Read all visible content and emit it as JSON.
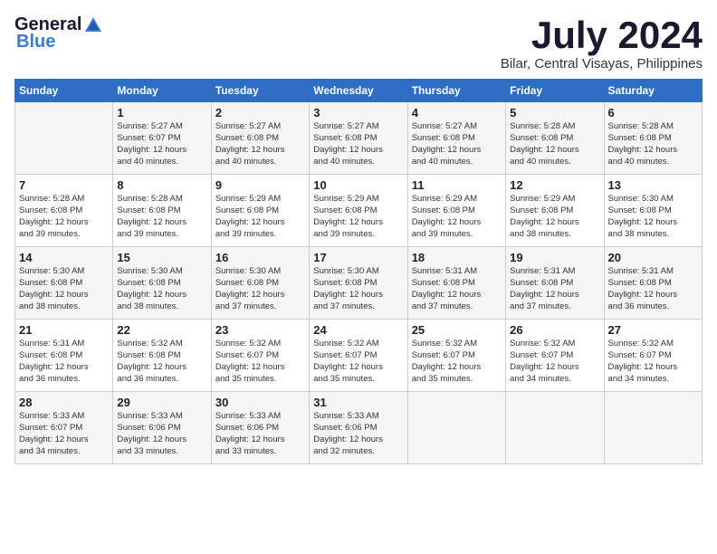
{
  "logo": {
    "general": "General",
    "blue": "Blue"
  },
  "title": {
    "month": "July 2024",
    "location": "Bilar, Central Visayas, Philippines"
  },
  "headers": [
    "Sunday",
    "Monday",
    "Tuesday",
    "Wednesday",
    "Thursday",
    "Friday",
    "Saturday"
  ],
  "weeks": [
    [
      {
        "day": "",
        "content": ""
      },
      {
        "day": "1",
        "content": "Sunrise: 5:27 AM\nSunset: 6:07 PM\nDaylight: 12 hours\nand 40 minutes."
      },
      {
        "day": "2",
        "content": "Sunrise: 5:27 AM\nSunset: 6:08 PM\nDaylight: 12 hours\nand 40 minutes."
      },
      {
        "day": "3",
        "content": "Sunrise: 5:27 AM\nSunset: 6:08 PM\nDaylight: 12 hours\nand 40 minutes."
      },
      {
        "day": "4",
        "content": "Sunrise: 5:27 AM\nSunset: 6:08 PM\nDaylight: 12 hours\nand 40 minutes."
      },
      {
        "day": "5",
        "content": "Sunrise: 5:28 AM\nSunset: 6:08 PM\nDaylight: 12 hours\nand 40 minutes."
      },
      {
        "day": "6",
        "content": "Sunrise: 5:28 AM\nSunset: 6:08 PM\nDaylight: 12 hours\nand 40 minutes."
      }
    ],
    [
      {
        "day": "7",
        "content": "Sunrise: 5:28 AM\nSunset: 6:08 PM\nDaylight: 12 hours\nand 39 minutes."
      },
      {
        "day": "8",
        "content": "Sunrise: 5:28 AM\nSunset: 6:08 PM\nDaylight: 12 hours\nand 39 minutes."
      },
      {
        "day": "9",
        "content": "Sunrise: 5:29 AM\nSunset: 6:08 PM\nDaylight: 12 hours\nand 39 minutes."
      },
      {
        "day": "10",
        "content": "Sunrise: 5:29 AM\nSunset: 6:08 PM\nDaylight: 12 hours\nand 39 minutes."
      },
      {
        "day": "11",
        "content": "Sunrise: 5:29 AM\nSunset: 6:08 PM\nDaylight: 12 hours\nand 39 minutes."
      },
      {
        "day": "12",
        "content": "Sunrise: 5:29 AM\nSunset: 6:08 PM\nDaylight: 12 hours\nand 38 minutes."
      },
      {
        "day": "13",
        "content": "Sunrise: 5:30 AM\nSunset: 6:08 PM\nDaylight: 12 hours\nand 38 minutes."
      }
    ],
    [
      {
        "day": "14",
        "content": "Sunrise: 5:30 AM\nSunset: 6:08 PM\nDaylight: 12 hours\nand 38 minutes."
      },
      {
        "day": "15",
        "content": "Sunrise: 5:30 AM\nSunset: 6:08 PM\nDaylight: 12 hours\nand 38 minutes."
      },
      {
        "day": "16",
        "content": "Sunrise: 5:30 AM\nSunset: 6:08 PM\nDaylight: 12 hours\nand 37 minutes."
      },
      {
        "day": "17",
        "content": "Sunrise: 5:30 AM\nSunset: 6:08 PM\nDaylight: 12 hours\nand 37 minutes."
      },
      {
        "day": "18",
        "content": "Sunrise: 5:31 AM\nSunset: 6:08 PM\nDaylight: 12 hours\nand 37 minutes."
      },
      {
        "day": "19",
        "content": "Sunrise: 5:31 AM\nSunset: 6:08 PM\nDaylight: 12 hours\nand 37 minutes."
      },
      {
        "day": "20",
        "content": "Sunrise: 5:31 AM\nSunset: 6:08 PM\nDaylight: 12 hours\nand 36 minutes."
      }
    ],
    [
      {
        "day": "21",
        "content": "Sunrise: 5:31 AM\nSunset: 6:08 PM\nDaylight: 12 hours\nand 36 minutes."
      },
      {
        "day": "22",
        "content": "Sunrise: 5:32 AM\nSunset: 6:08 PM\nDaylight: 12 hours\nand 36 minutes."
      },
      {
        "day": "23",
        "content": "Sunrise: 5:32 AM\nSunset: 6:07 PM\nDaylight: 12 hours\nand 35 minutes."
      },
      {
        "day": "24",
        "content": "Sunrise: 5:32 AM\nSunset: 6:07 PM\nDaylight: 12 hours\nand 35 minutes."
      },
      {
        "day": "25",
        "content": "Sunrise: 5:32 AM\nSunset: 6:07 PM\nDaylight: 12 hours\nand 35 minutes."
      },
      {
        "day": "26",
        "content": "Sunrise: 5:32 AM\nSunset: 6:07 PM\nDaylight: 12 hours\nand 34 minutes."
      },
      {
        "day": "27",
        "content": "Sunrise: 5:32 AM\nSunset: 6:07 PM\nDaylight: 12 hours\nand 34 minutes."
      }
    ],
    [
      {
        "day": "28",
        "content": "Sunrise: 5:33 AM\nSunset: 6:07 PM\nDaylight: 12 hours\nand 34 minutes."
      },
      {
        "day": "29",
        "content": "Sunrise: 5:33 AM\nSunset: 6:06 PM\nDaylight: 12 hours\nand 33 minutes."
      },
      {
        "day": "30",
        "content": "Sunrise: 5:33 AM\nSunset: 6:06 PM\nDaylight: 12 hours\nand 33 minutes."
      },
      {
        "day": "31",
        "content": "Sunrise: 5:33 AM\nSunset: 6:06 PM\nDaylight: 12 hours\nand 32 minutes."
      },
      {
        "day": "",
        "content": ""
      },
      {
        "day": "",
        "content": ""
      },
      {
        "day": "",
        "content": ""
      }
    ]
  ]
}
